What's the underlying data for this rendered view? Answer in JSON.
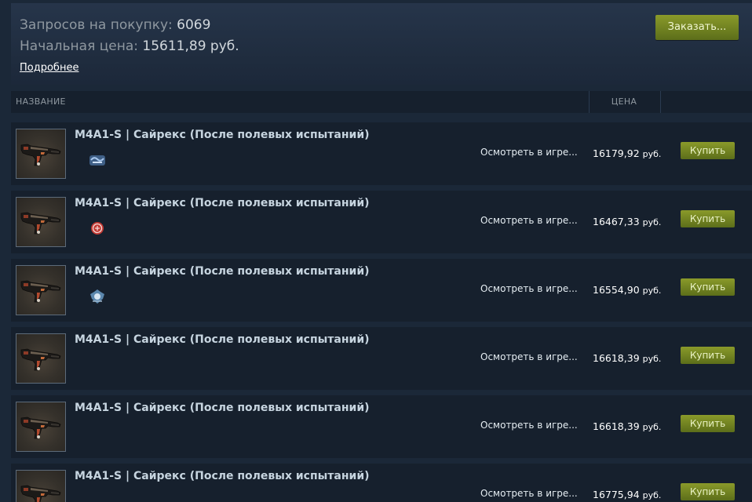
{
  "summary": {
    "requests_label": "Запросов на покупку:",
    "requests_value": "6069",
    "start_price_label": "Начальная цена:",
    "start_price_value": "15611,89 руб.",
    "more_link": "Подробнее",
    "order_button": "Заказать..."
  },
  "table": {
    "col_name": "НАЗВАНИЕ",
    "col_price": "ЦЕНА"
  },
  "listings": [
    {
      "name": "M4A1-S | Сайрекс (После полевых испытаний)",
      "inspect": "Осмотреть в игре...",
      "price": "16179,92",
      "currency": "руб.",
      "buy": "Купить",
      "sticker": "sticker-blue-graffiti"
    },
    {
      "name": "M4A1-S | Сайрекс (После полевых испытаний)",
      "inspect": "Осмотреть в игре...",
      "price": "16467,33",
      "currency": "руб.",
      "buy": "Купить",
      "sticker": "sticker-red-circle"
    },
    {
      "name": "M4A1-S | Сайрекс (После полевых испытаний)",
      "inspect": "Осмотреть в игре...",
      "price": "16554,90",
      "currency": "руб.",
      "buy": "Купить",
      "sticker": "sticker-blue-emblem"
    },
    {
      "name": "M4A1-S | Сайрекс (После полевых испытаний)",
      "inspect": "Осмотреть в игре...",
      "price": "16618,39",
      "currency": "руб.",
      "buy": "Купить",
      "sticker": ""
    },
    {
      "name": "M4A1-S | Сайрекс (После полевых испытаний)",
      "inspect": "Осмотреть в игре...",
      "price": "16618,39",
      "currency": "руб.",
      "buy": "Купить",
      "sticker": ""
    },
    {
      "name": "M4A1-S | Сайрекс (После полевых испытаний)",
      "inspect": "Осмотреть в игре...",
      "price": "16775,94",
      "currency": "руб.",
      "buy": "Купить",
      "sticker": ""
    }
  ],
  "colors": {
    "background": "#1b2838",
    "row_background": "#16202d",
    "button_green": "#8a9a2a",
    "text_muted": "#8f98a0"
  }
}
